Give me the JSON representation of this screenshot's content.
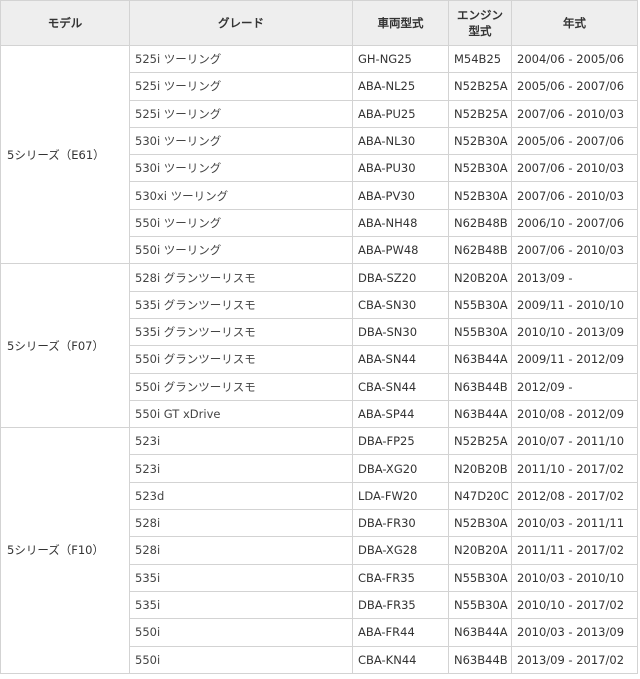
{
  "headers": {
    "model": "モデル",
    "grade": "グレード",
    "chassis": "車両型式",
    "engine_line1": "エンジン",
    "engine_line2": "型式",
    "years": "年式"
  },
  "groups": [
    {
      "model": "5シリーズ（E61）",
      "rows": [
        {
          "grade": "525i ツーリング",
          "chassis": "GH-NG25",
          "engine": "M54B25",
          "years": "2004/06 - 2005/06"
        },
        {
          "grade": "525i ツーリング",
          "chassis": "ABA-NL25",
          "engine": "N52B25A",
          "years": "2005/06 - 2007/06"
        },
        {
          "grade": "525i ツーリング",
          "chassis": "ABA-PU25",
          "engine": "N52B25A",
          "years": "2007/06 - 2010/03"
        },
        {
          "grade": "530i ツーリング",
          "chassis": "ABA-NL30",
          "engine": "N52B30A",
          "years": "2005/06 - 2007/06"
        },
        {
          "grade": "530i ツーリング",
          "chassis": "ABA-PU30",
          "engine": "N52B30A",
          "years": "2007/06 - 2010/03"
        },
        {
          "grade": "530xi ツーリング",
          "chassis": "ABA-PV30",
          "engine": "N52B30A",
          "years": "2007/06 - 2010/03"
        },
        {
          "grade": "550i ツーリング",
          "chassis": "ABA-NH48",
          "engine": "N62B48B",
          "years": "2006/10 - 2007/06"
        },
        {
          "grade": "550i ツーリング",
          "chassis": "ABA-PW48",
          "engine": "N62B48B",
          "years": "2007/06 - 2010/03"
        }
      ]
    },
    {
      "model": "5シリーズ（F07）",
      "rows": [
        {
          "grade": "528i グランツーリスモ",
          "chassis": "DBA-SZ20",
          "engine": "N20B20A",
          "years": "2013/09 -"
        },
        {
          "grade": "535i グランツーリスモ",
          "chassis": "CBA-SN30",
          "engine": "N55B30A",
          "years": "2009/11 - 2010/10"
        },
        {
          "grade": "535i グランツーリスモ",
          "chassis": "DBA-SN30",
          "engine": "N55B30A",
          "years": "2010/10 - 2013/09"
        },
        {
          "grade": "550i グランツーリスモ",
          "chassis": "ABA-SN44",
          "engine": "N63B44A",
          "years": "2009/11 - 2012/09"
        },
        {
          "grade": "550i グランツーリスモ",
          "chassis": "CBA-SN44",
          "engine": "N63B44B",
          "years": "2012/09 -"
        },
        {
          "grade": "550i GT xDrive",
          "chassis": "ABA-SP44",
          "engine": "N63B44A",
          "years": "2010/08 - 2012/09"
        }
      ]
    },
    {
      "model": "5シリーズ（F10）",
      "rows": [
        {
          "grade": "523i",
          "chassis": "DBA-FP25",
          "engine": "N52B25A",
          "years": "2010/07 - 2011/10"
        },
        {
          "grade": "523i",
          "chassis": "DBA-XG20",
          "engine": "N20B20B",
          "years": "2011/10 - 2017/02"
        },
        {
          "grade": "523d",
          "chassis": "LDA-FW20",
          "engine": "N47D20C",
          "years": "2012/08 - 2017/02"
        },
        {
          "grade": "528i",
          "chassis": "DBA-FR30",
          "engine": "N52B30A",
          "years": "2010/03 - 2011/11"
        },
        {
          "grade": "528i",
          "chassis": "DBA-XG28",
          "engine": "N20B20A",
          "years": "2011/11 - 2017/02"
        },
        {
          "grade": "535i",
          "chassis": "CBA-FR35",
          "engine": "N55B30A",
          "years": "2010/03 - 2010/10"
        },
        {
          "grade": "535i",
          "chassis": "DBA-FR35",
          "engine": "N55B30A",
          "years": "2010/10 - 2017/02"
        },
        {
          "grade": "550i",
          "chassis": "ABA-FR44",
          "engine": "N63B44A",
          "years": "2010/03 - 2013/09"
        },
        {
          "grade": "550i",
          "chassis": "CBA-KN44",
          "engine": "N63B44B",
          "years": "2013/09 - 2017/02"
        }
      ]
    }
  ]
}
